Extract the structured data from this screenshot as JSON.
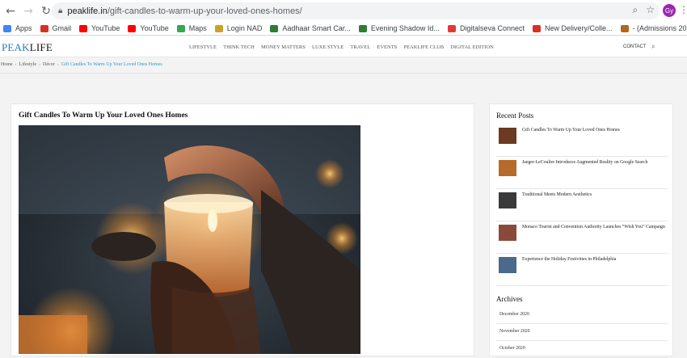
{
  "browser": {
    "url_host": "peaklife.in",
    "url_path": "/gift-candles-to-warm-up-your-loved-ones-homes/",
    "profile_initials": "Gy"
  },
  "bookmarks": [
    {
      "label": "Apps",
      "icon": "apps-grid-icon",
      "color": "#4285f4"
    },
    {
      "label": "Gmail",
      "icon": "gmail-icon",
      "color": "#d93025"
    },
    {
      "label": "YouTube",
      "icon": "youtube-icon",
      "color": "#ff0000"
    },
    {
      "label": "YouTube",
      "icon": "youtube-icon",
      "color": "#ff0000"
    },
    {
      "label": "Maps",
      "icon": "maps-pin-icon",
      "color": "#34a853"
    },
    {
      "label": "Login NAD",
      "icon": "nad-icon",
      "color": "#c9a227"
    },
    {
      "label": "Aadhaar Smart Car...",
      "icon": "aadhaar-icon",
      "color": "#2e7d32"
    },
    {
      "label": "Evening Shadow Id...",
      "icon": "evening-shadow-icon",
      "color": "#2e7d32"
    },
    {
      "label": "Digitalseva Connect",
      "icon": "digitalseva-icon",
      "color": "#e53935"
    },
    {
      "label": "New Delivery/Colle...",
      "icon": "gmail-icon",
      "color": "#d93025"
    },
    {
      "label": "- (Admissions 2020...",
      "icon": "admissions-icon",
      "color": "#b5651d"
    }
  ],
  "site": {
    "logo_a": "PEAK",
    "logo_b": "LIFE",
    "nav": [
      "LIFESTYLE",
      "THINK TECH",
      "MONEY MATTERS",
      "LUXE STYLE",
      "TRAVEL",
      "EVENTS",
      "PEAKLIFE CLUB",
      "DIGITAL EDITION"
    ],
    "contact": "CONTACT"
  },
  "breadcrumb": {
    "home": "Home",
    "lifestyle": "Lifestyle",
    "decor": "Décor",
    "current": "Gift Candles To Warm Up Your Loved Ones Homes"
  },
  "article": {
    "title": "Gift Candles To Warm Up Your Loved Ones Homes"
  },
  "sidebar": {
    "recent_heading": "Recent Posts",
    "recent_posts": [
      {
        "title": "Gift Candles To Warm Up Your Loved Ones Homes",
        "thumb_color": "#6b3a20"
      },
      {
        "title": "Jaeger-LeCoultre Introduces Augmented Reality on Google Search",
        "thumb_color": "#b86a2a"
      },
      {
        "title": "Traditional Meets Modern Aesthetics",
        "thumb_color": "#3a3a3a"
      },
      {
        "title": "Monaco Tourist and Convention Authority Launches “Wish You” Campaign",
        "thumb_color": "#8a4a3a"
      },
      {
        "title": "Experience the Holiday Festivities in Philadelphia",
        "thumb_color": "#4a6a8a"
      }
    ],
    "archives_heading": "Archives",
    "archives": [
      "December 2020",
      "November 2020",
      "October 2020"
    ]
  }
}
